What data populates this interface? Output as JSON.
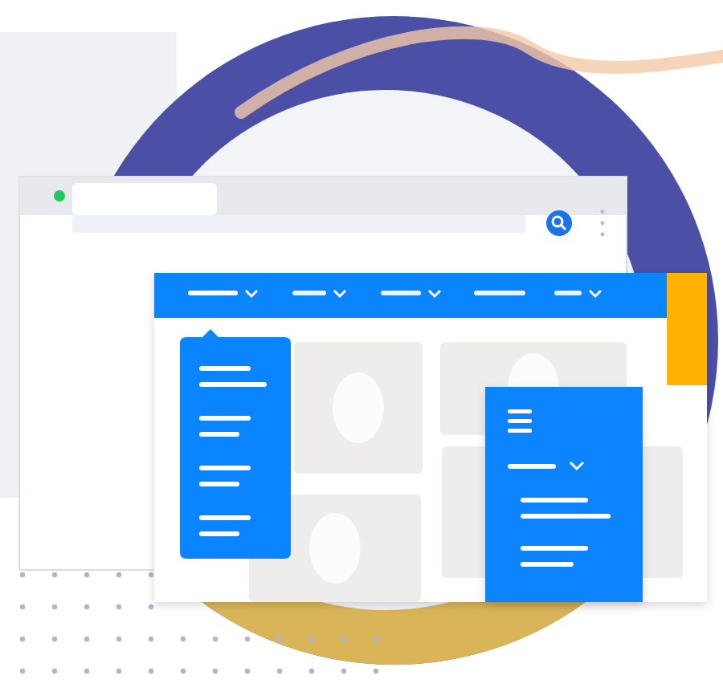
{
  "browser": {
    "tabs": [
      {
        "selected": true
      }
    ]
  },
  "navbar": {
    "items": [
      {
        "kind": "dropdown",
        "selected": true
      },
      {
        "kind": "dropdown",
        "selected": false
      },
      {
        "kind": "dropdown",
        "selected": false
      },
      {
        "kind": "plain",
        "selected": false
      },
      {
        "kind": "dropdown",
        "selected": false
      }
    ]
  },
  "dropdown_menu": {
    "expanded": true,
    "items": [
      {
        "kind": "long"
      },
      {
        "kind": "short"
      },
      {
        "kind": "short"
      },
      {
        "kind": "short"
      }
    ]
  },
  "mobile_menu": {
    "expanded": true,
    "items": [
      {
        "kind": "long"
      },
      {
        "kind": "short"
      }
    ]
  }
}
